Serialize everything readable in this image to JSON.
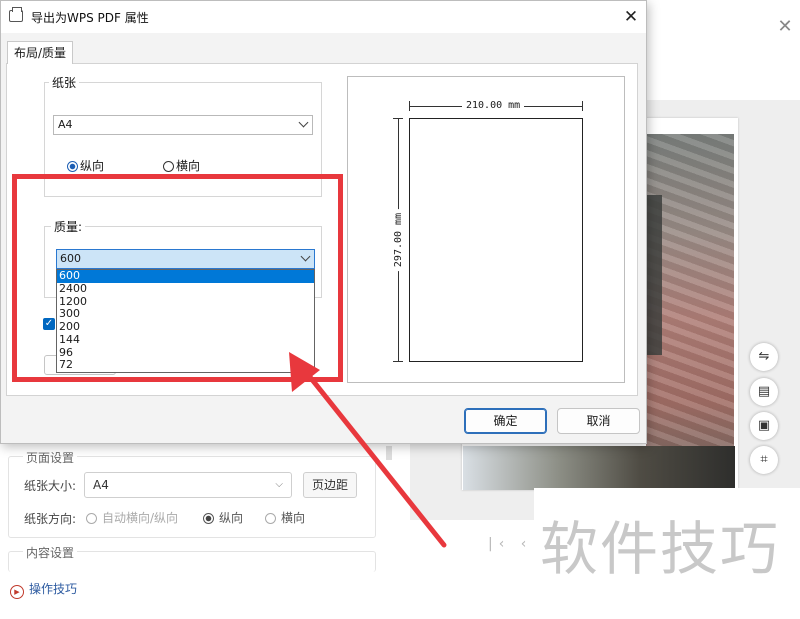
{
  "dialog": {
    "title": "导出为WPS PDF 属性",
    "close_symbol": "✕",
    "tab_label": "布局/质量",
    "paper": {
      "group_title": "纸张",
      "size_value": "A4",
      "orientation_portrait": "纵向",
      "orientation_landscape": "横向"
    },
    "quality": {
      "group_title": "质量:",
      "selected_value": "600",
      "options": [
        "600",
        "2400",
        "1200",
        "300",
        "200",
        "144",
        "96",
        "72"
      ]
    },
    "preview": {
      "width_label": "210.00 mm",
      "height_label": "297.00 mm"
    },
    "ok_label": "确定",
    "cancel_label": "取消"
  },
  "background": {
    "close_symbol": "✕",
    "page_settings": {
      "group_title": "页面设置",
      "paper_size_label": "纸张大小:",
      "paper_size_value": "A4",
      "margin_button": "页边距",
      "orientation_label": "纸张方向:",
      "orientation_auto": "自动横向/纵向",
      "orientation_portrait": "纵向",
      "orientation_landscape": "横向"
    },
    "content_settings": {
      "group_title": "内容设置"
    },
    "tips_label": "操作技巧",
    "watermark": "软件技巧"
  },
  "colors": {
    "highlight": "#e8383d",
    "accent": "#0078d7"
  }
}
